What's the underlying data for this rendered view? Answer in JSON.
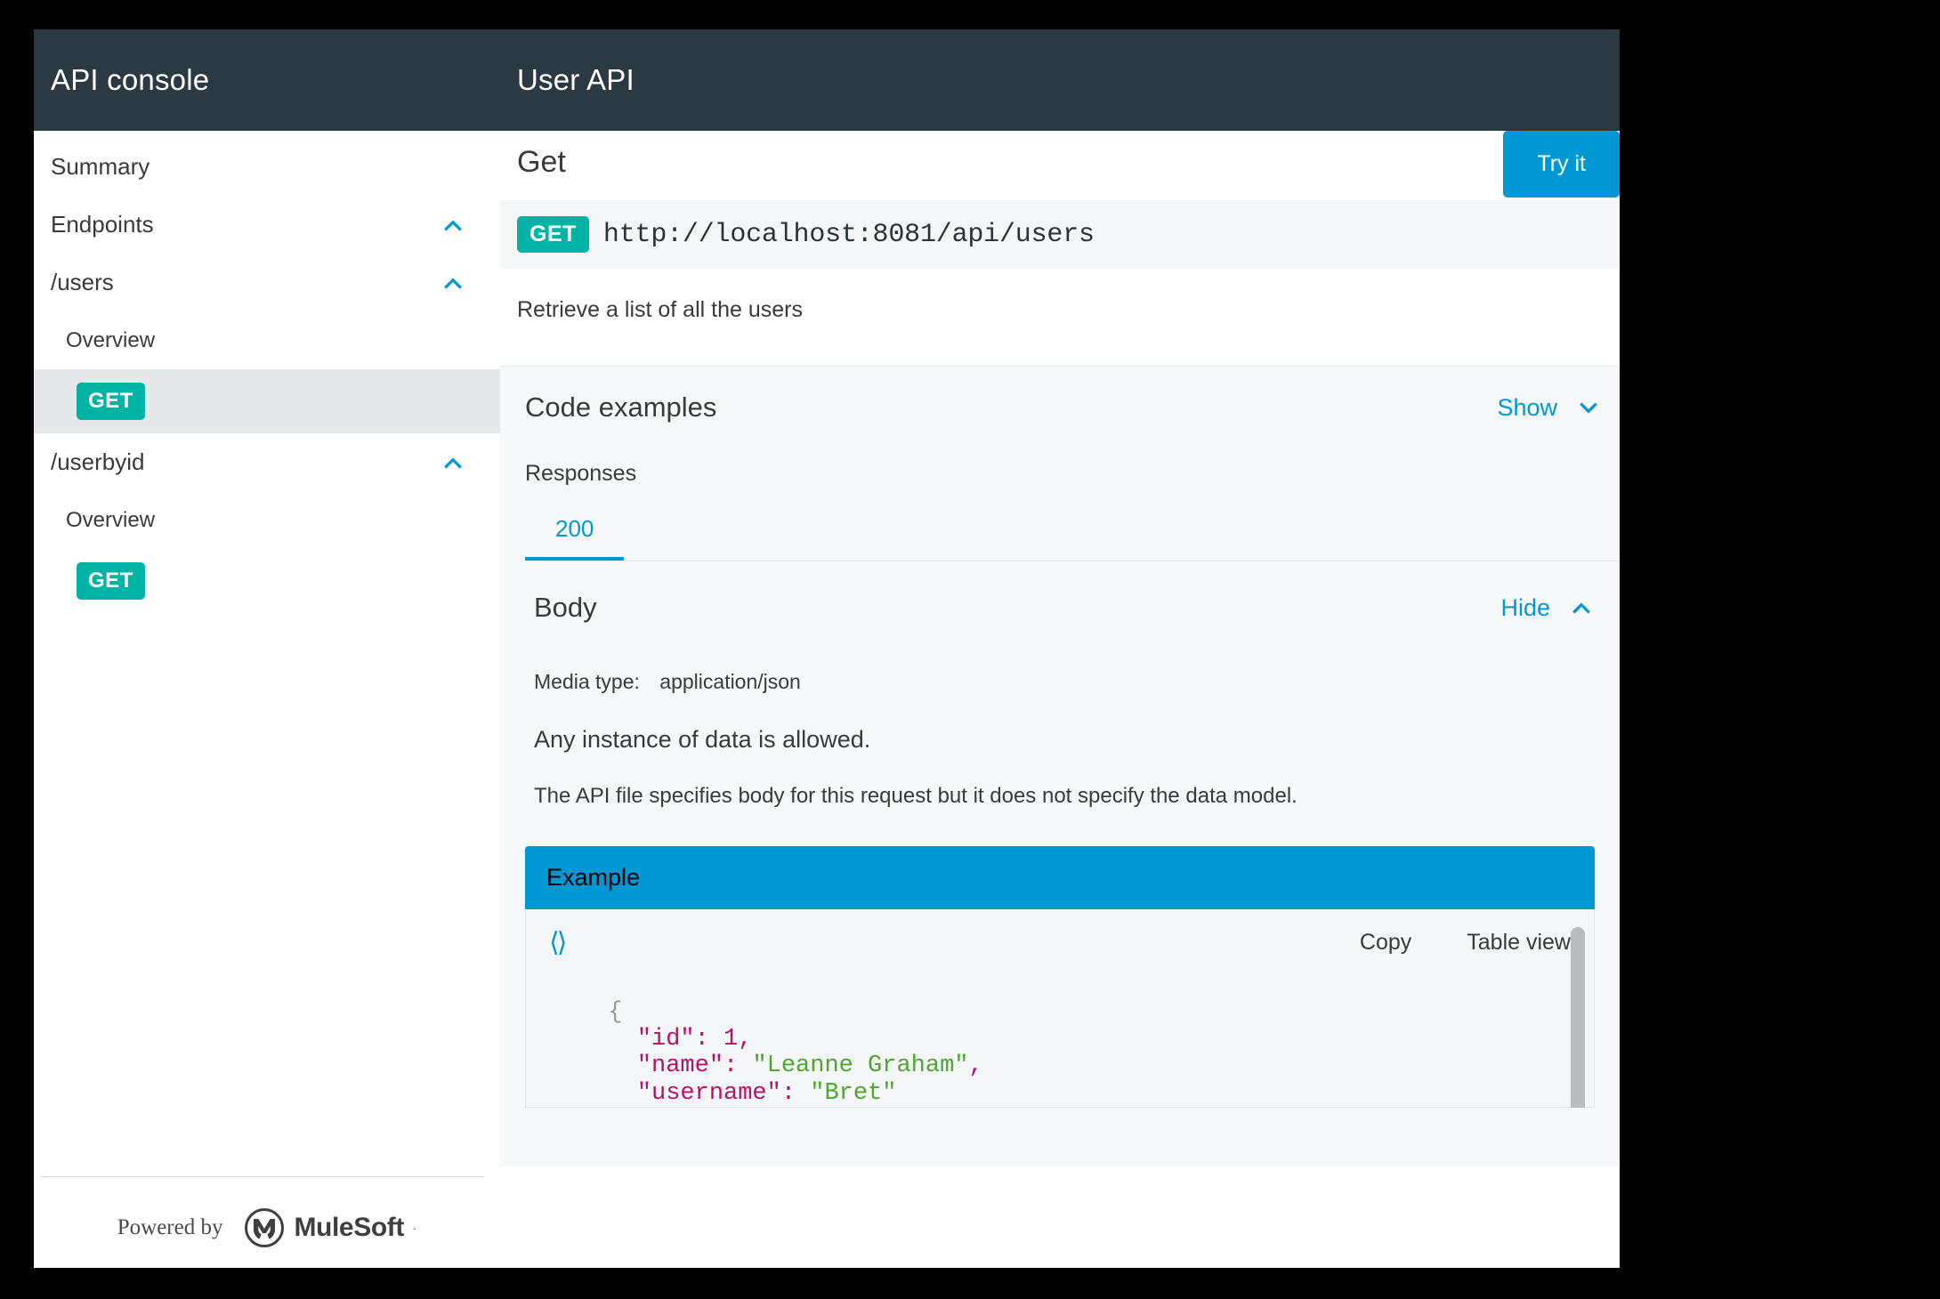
{
  "topbar": {
    "brand": "API console",
    "title": "User API"
  },
  "sidebar": {
    "items": [
      {
        "label": "Summary",
        "level": 0,
        "icon": null,
        "selected": false
      },
      {
        "label": "Endpoints",
        "level": 0,
        "icon": "chevron-up-icon",
        "selected": false
      },
      {
        "label": "/users",
        "level": 1,
        "icon": "chevron-up-icon",
        "selected": false
      },
      {
        "label": "Overview",
        "level": 2,
        "icon": null,
        "selected": false
      },
      {
        "label": "GET",
        "level": 2,
        "icon": null,
        "selected": true,
        "badge": true
      },
      {
        "label": "/userbyid",
        "level": 1,
        "icon": "chevron-up-icon",
        "selected": false
      },
      {
        "label": "Overview",
        "level": 2,
        "icon": null,
        "selected": false
      },
      {
        "label": "GET",
        "level": 2,
        "icon": null,
        "selected": false,
        "badge": true
      }
    ],
    "footer": {
      "powered_by": "Powered by",
      "brand": "MuleSoft",
      "trademark": "·"
    }
  },
  "main": {
    "title": "Get",
    "try_it_label": "Try it",
    "method": "GET",
    "url": "http://localhost:8081/api/users",
    "description": "Retrieve a list of all the users",
    "code_examples": {
      "title": "Code examples",
      "toggle_label": "Show",
      "toggle_icon": "chevron-down-icon"
    },
    "responses": {
      "label": "Responses",
      "tabs": [
        {
          "label": "200",
          "active": true
        }
      ]
    },
    "body": {
      "title": "Body",
      "toggle_label": "Hide",
      "toggle_icon": "chevron-up-icon",
      "media_type_label": "Media type:",
      "media_type_value": "application/json",
      "any_instance": "Any instance of data is allowed.",
      "no_data_model": "The API file specifies body for this request but it does not specify the data model."
    },
    "example": {
      "header": "Example",
      "code_icon": "code-brackets-icon",
      "copy_label": "Copy",
      "table_view_label": "Table view",
      "lines": [
        {
          "indent": 2,
          "tokens": [
            {
              "t": "brace",
              "v": "{"
            }
          ]
        },
        {
          "indent": 4,
          "tokens": [
            {
              "t": "key",
              "v": "\"id\""
            },
            {
              "t": "colon",
              "v": ":"
            },
            {
              "t": "plain",
              "v": " "
            },
            {
              "t": "num",
              "v": "1"
            },
            {
              "t": "punc",
              "v": ","
            }
          ]
        },
        {
          "indent": 4,
          "tokens": [
            {
              "t": "key",
              "v": "\"name\""
            },
            {
              "t": "colon",
              "v": ":"
            },
            {
              "t": "plain",
              "v": " "
            },
            {
              "t": "str",
              "v": "\"Leanne Graham\""
            },
            {
              "t": "punc",
              "v": ","
            }
          ]
        },
        {
          "indent": 4,
          "tokens": [
            {
              "t": "key",
              "v": "\"username\""
            },
            {
              "t": "colon",
              "v": ":"
            },
            {
              "t": "plain",
              "v": " "
            },
            {
              "t": "str",
              "v": "\"Bret\""
            }
          ]
        }
      ]
    }
  },
  "colors": {
    "topbar": "#2b3a42",
    "accent_blue": "#0098d4",
    "method_teal": "#00b3a4",
    "panel_bg": "#f6f8f9",
    "selected_row": "#e6e8ea"
  }
}
